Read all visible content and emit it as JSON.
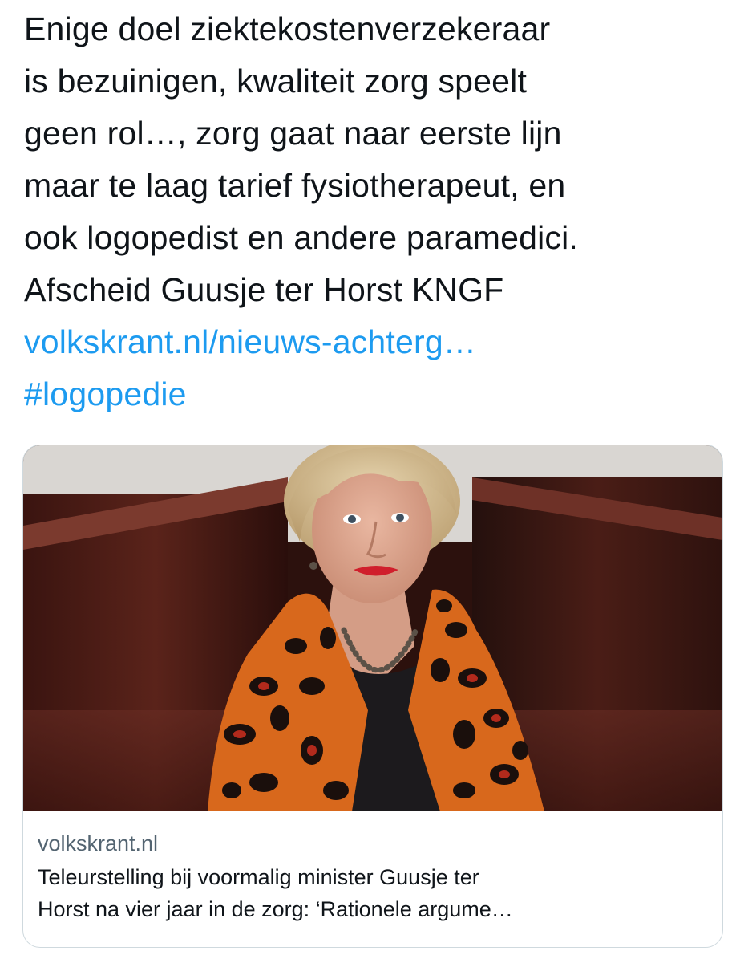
{
  "tweet": {
    "lines": [
      "Enige doel ziektekostenverzekeraar",
      "is bezuinigen, kwaliteit zorg speelt",
      "geen rol…, zorg gaat naar eerste lijn",
      "maar te laag tarief fysiotherapeut, en",
      "ook logopedist en andere paramedici.",
      "Afscheid Guusje ter Horst KNGF"
    ],
    "link_text": "volkskrant.nl/nieuws-achterg…",
    "hashtag": "#logopedie"
  },
  "card": {
    "image_subject": "portrait-photo",
    "domain": "volkskrant.nl",
    "title_line_1": "Teleurstelling bij voormalig minister Guusje ter",
    "title_line_2": "Horst na vier jaar in de zorg: ‘Rationele argume…"
  },
  "colors": {
    "link": "#1d9bf0",
    "text": "#0f1419",
    "secondary_text": "#536471",
    "card_border": "#cfd9de"
  }
}
